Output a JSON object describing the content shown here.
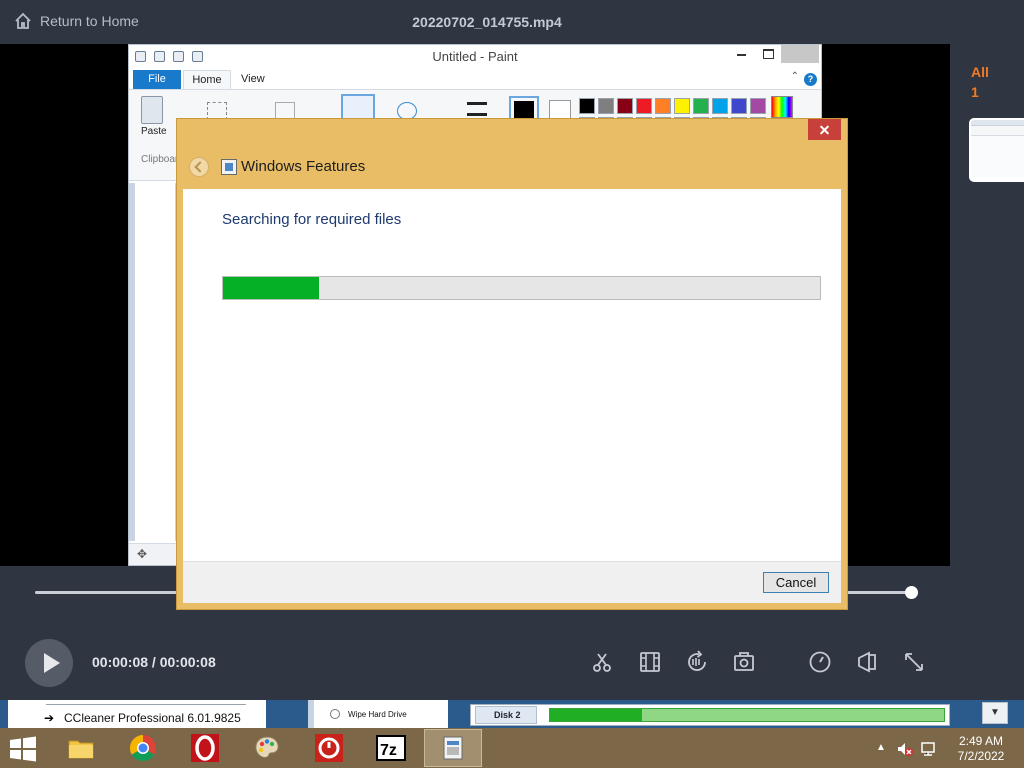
{
  "player": {
    "back_label": "Return to Home",
    "file_name": "20220702_014755.mp4",
    "side_label": "All",
    "side_count": "1",
    "time": "00:00:08 / 00:00:08",
    "progress_fraction": 1.0
  },
  "paint": {
    "title": "Untitled - Paint",
    "tabs": [
      "File",
      "Home",
      "View"
    ],
    "paste_label": "Paste",
    "clipboard_label": "Clipboard",
    "swatches": [
      "#000000",
      "#7f7f7f",
      "#880015",
      "#ed1c24",
      "#ff7f27",
      "#fff200",
      "#22b14c",
      "#00a2e8",
      "#3f48cc",
      "#a349a4",
      "#ffffff",
      "#c3c3c3",
      "#b97a57",
      "#ffaec9",
      "#ffc90e",
      "#efe4b0",
      "#b5e61d",
      "#99d9ea",
      "#7092be",
      "#c8bfe7"
    ]
  },
  "dialog": {
    "title": "Windows Features",
    "status": "Searching for required files",
    "progress_fraction": 0.16,
    "cancel_label": "Cancel"
  },
  "background": {
    "app_item": "CCleaner Professional 6.01.9825",
    "menu_item": "Wipe Hard Drive",
    "disk_label": "Disk 2"
  },
  "taskbar": {
    "time": "2:49 AM",
    "date": "7/2/2022",
    "apps": [
      "file-explorer",
      "chrome",
      "opera",
      "paint",
      "ccleaner",
      "7-zip",
      "windows-features"
    ]
  },
  "colors": {
    "accent_orange": "#f07a25",
    "progress_green": "#06b025",
    "dialog_frame": "#e8bd66",
    "taskbar": "#7c6848"
  }
}
